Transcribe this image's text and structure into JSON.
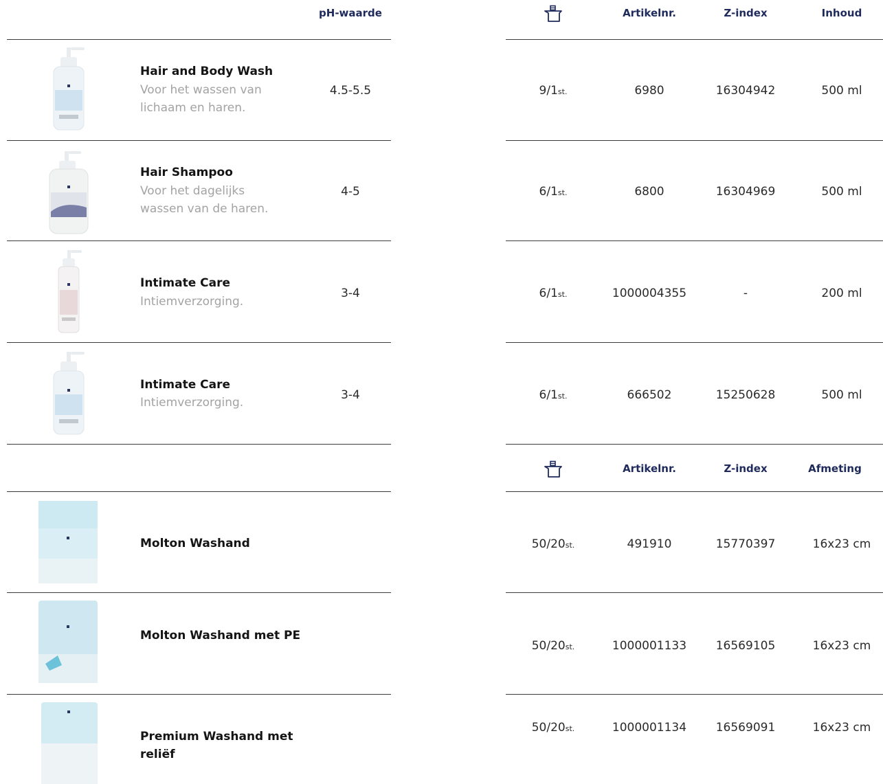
{
  "header_top": {
    "ph_label": "pH-waarde",
    "package_icon": "package-box-icon",
    "artikelnr_label": "Artikelnr.",
    "zindex_label": "Z-index",
    "content_label": "Inhoud"
  },
  "header_bottom": {
    "package_icon": "package-box-icon",
    "artikelnr_label": "Artikelnr.",
    "zindex_label": "Z-index",
    "size_label": "Afmeting"
  },
  "products": [
    {
      "name": "Hair and Body Wash",
      "description": "Voor het wassen van lichaam en haren.",
      "ph": "4.5-5.5",
      "pack_count": "9/1",
      "pack_unit": "st.",
      "artikelnr": "6980",
      "zindex": "16304942",
      "content": "500 ml",
      "image": "pump-bottle-icon"
    },
    {
      "name": "Hair Shampoo",
      "description": "Voor het dagelijks wassen van de haren.",
      "ph": "4-5",
      "pack_count": "6/1",
      "pack_unit": "st.",
      "artikelnr": "6800",
      "zindex": "16304969",
      "content": "500 ml",
      "image": "pump-bottle-icon"
    },
    {
      "name": "Intimate Care",
      "description": "Intiemverzorging.",
      "ph": "3-4",
      "pack_count": "6/1",
      "pack_unit": "st.",
      "artikelnr": "1000004355",
      "zindex": "-",
      "content": "200 ml",
      "image": "slim-pump-bottle-icon"
    },
    {
      "name": "Intimate Care",
      "description": "Intiemverzorging.",
      "ph": "3-4",
      "pack_count": "6/1",
      "pack_unit": "st.",
      "artikelnr": "666502",
      "zindex": "15250628",
      "content": "500 ml",
      "image": "pump-bottle-icon"
    }
  ],
  "washcloths": [
    {
      "name": "Molton Washand",
      "pack_count": "50/20",
      "pack_unit": "st.",
      "artikelnr": "491910",
      "zindex": "15770397",
      "size": "16x23 cm",
      "image": "washcloth-pack-icon"
    },
    {
      "name": "Molton Washand met PE",
      "pack_count": "50/20",
      "pack_unit": "st.",
      "artikelnr": "1000001133",
      "zindex": "16569105",
      "size": "16x23 cm",
      "image": "washcloth-pack-icon"
    },
    {
      "name": "Premium Washand met reliëf",
      "pack_count": "50/20",
      "pack_unit": "st.",
      "artikelnr": "1000001134",
      "zindex": "16569091",
      "size": "16x23 cm",
      "image": "washcloth-pack-icon"
    }
  ],
  "colors": {
    "header_text": "#1f2a5c",
    "title_text": "#141414",
    "description_text": "#a3a3a3",
    "rule": "#3a3a3a"
  }
}
